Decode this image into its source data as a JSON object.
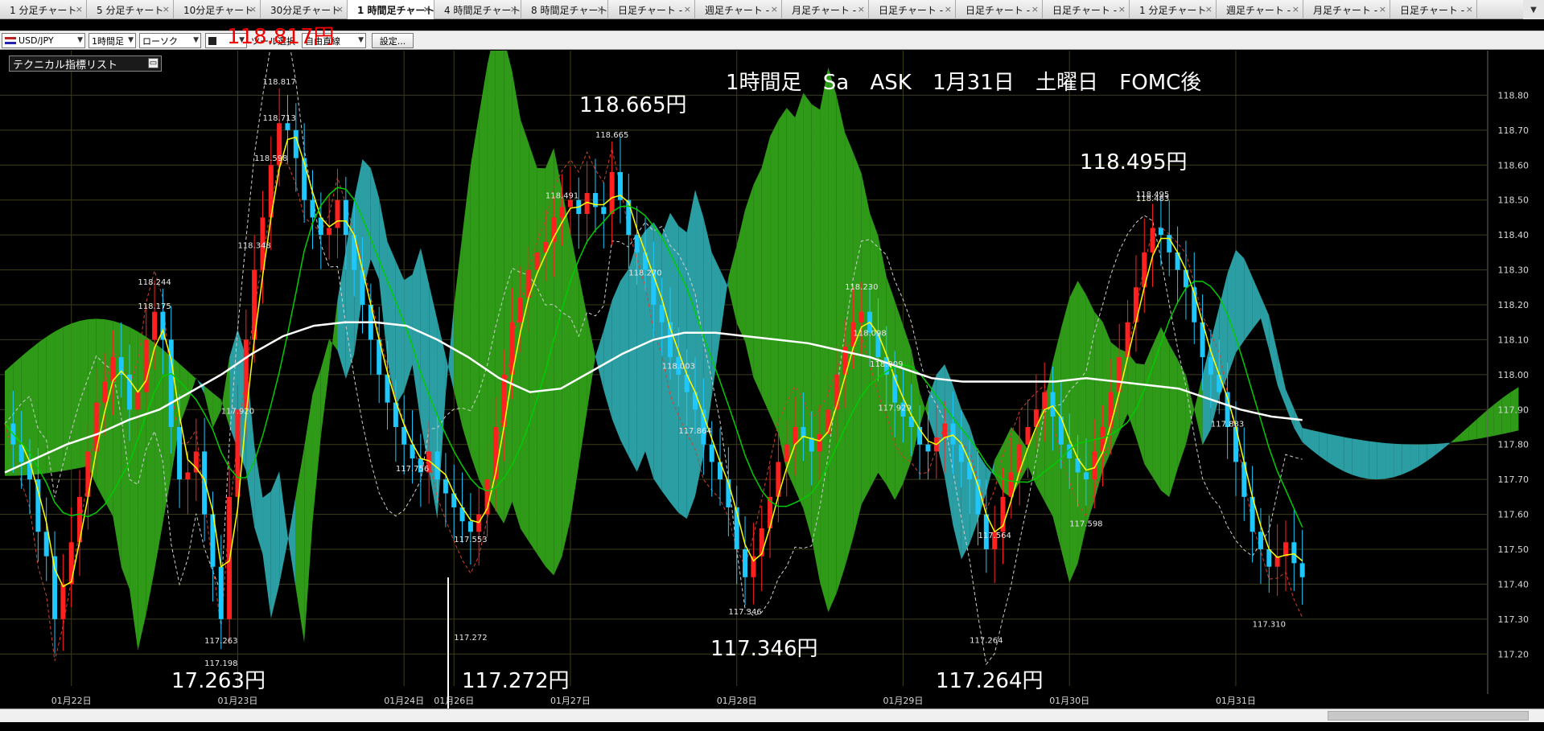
{
  "tabs": [
    {
      "label": "1 分足チャート",
      "active": false
    },
    {
      "label": "5 分足チャート",
      "active": false
    },
    {
      "label": "10分足チャート",
      "active": false
    },
    {
      "label": "30分足チャート",
      "active": false
    },
    {
      "label": "1 時間足チャート",
      "active": true
    },
    {
      "label": "4 時間足チャート",
      "active": false
    },
    {
      "label": "8 時間足チャート",
      "active": false
    },
    {
      "label": "日足チャート -",
      "active": false
    },
    {
      "label": "週足チャート -",
      "active": false
    },
    {
      "label": "月足チャート -",
      "active": false
    },
    {
      "label": "日足チャート -",
      "active": false
    },
    {
      "label": "日足チャート -",
      "active": false
    },
    {
      "label": "日足チャート -",
      "active": false
    },
    {
      "label": "1 分足チャート",
      "active": false
    },
    {
      "label": "週足チャート -",
      "active": false
    },
    {
      "label": "月足チャート -",
      "active": false
    },
    {
      "label": "日足チャート -",
      "active": false
    }
  ],
  "tab_close_glyph": "×",
  "tab_scroll_glyph": "▼",
  "toolbar": {
    "symbol": "USD/JPY",
    "timeframe": "1時間足",
    "chart_type": "ローソク",
    "tool_label": "ツール選択",
    "tool": "自由直線",
    "settings": "設定..."
  },
  "overlays": {
    "title": "1時間足 Sa ASK 1月31日 土曜日 FOMC後",
    "price_red": "118.817円",
    "tech_list": "テクニカル指標リスト",
    "callouts": [
      "118.665円",
      "118.495円",
      "17.263円",
      "117.272円",
      "117.346円",
      "117.264円"
    ]
  },
  "colors": {
    "background": "#000000",
    "bull_candle": "#ff2020",
    "bear_candle": "#1ec8ff",
    "sma_short": "#ffff00",
    "sma_mid": "#00cc00",
    "sma_long": "#ffffff",
    "kumo_bull": "#2e9a18",
    "kumo_bear": "#2a9ea3",
    "grid": "#3d3d18"
  },
  "chart_data": {
    "type": "candlestick",
    "symbol": "USD/JPY",
    "timeframe": "1時間足",
    "ylim": [
      117.15,
      118.9
    ],
    "y_ticks": [
      "118.80",
      "118.70",
      "118.60",
      "118.50",
      "118.40",
      "118.30",
      "118.20",
      "118.10",
      "118.00",
      "117.90",
      "117.80",
      "117.70",
      "117.60",
      "117.50",
      "117.40",
      "117.30",
      "117.20"
    ],
    "x_ticks": [
      {
        "label": "01月22日",
        "t": 8
      },
      {
        "label": "01月23日",
        "t": 28
      },
      {
        "label": "01月24日",
        "t": 48
      },
      {
        "label": "01月26日",
        "t": 54
      },
      {
        "label": "01月27日",
        "t": 68
      },
      {
        "label": "01月28日",
        "t": 88
      },
      {
        "label": "01月29日",
        "t": 108
      },
      {
        "label": "01月30日",
        "t": 128
      },
      {
        "label": "01月31日",
        "t": 148
      }
    ],
    "candle_close": [
      117.86,
      117.8,
      117.75,
      117.7,
      117.55,
      117.48,
      117.3,
      117.4,
      117.52,
      117.65,
      117.78,
      117.92,
      117.98,
      118.05,
      118.0,
      117.9,
      117.95,
      118.1,
      118.18,
      118.1,
      117.85,
      117.7,
      117.72,
      117.78,
      117.6,
      117.45,
      117.3,
      117.65,
      117.9,
      118.1,
      118.3,
      118.45,
      118.6,
      118.72,
      118.7,
      118.62,
      118.5,
      118.45,
      118.4,
      118.42,
      118.5,
      118.4,
      118.3,
      118.2,
      118.1,
      118.0,
      117.92,
      117.85,
      117.8,
      117.76,
      117.72,
      117.78,
      117.7,
      117.66,
      117.62,
      117.58,
      117.55,
      117.6,
      117.7,
      117.85,
      118.0,
      118.15,
      118.22,
      118.3,
      118.35,
      118.38,
      118.45,
      118.48,
      118.5,
      118.46,
      118.52,
      118.48,
      118.46,
      118.58,
      118.5,
      118.4,
      118.35,
      118.3,
      118.2,
      118.15,
      118.05,
      118.0,
      117.95,
      117.9,
      117.8,
      117.75,
      117.7,
      117.62,
      117.5,
      117.42,
      117.48,
      117.56,
      117.65,
      117.75,
      117.8,
      117.85,
      117.82,
      117.78,
      117.83,
      117.9,
      118.0,
      118.08,
      118.15,
      118.18,
      118.12,
      118.05,
      118.0,
      117.92,
      117.88,
      117.85,
      117.8,
      117.78,
      117.82,
      117.86,
      117.8,
      117.75,
      117.7,
      117.6,
      117.5,
      117.55,
      117.65,
      117.72,
      117.8,
      117.85,
      117.9,
      117.95,
      117.88,
      117.8,
      117.76,
      117.72,
      117.7,
      117.78,
      117.85,
      117.95,
      118.05,
      118.15,
      118.25,
      118.35,
      118.42,
      118.4,
      118.35,
      118.3,
      118.25,
      118.15,
      118.05,
      118.0,
      117.95,
      117.85,
      117.75,
      117.65,
      117.55,
      117.5,
      117.45,
      117.48,
      117.52,
      117.46,
      117.42
    ],
    "sma_long": [
      117.72,
      117.76,
      117.8,
      117.83,
      117.87,
      117.9,
      117.95,
      118.0,
      118.06,
      118.11,
      118.14,
      118.15,
      118.15,
      118.14,
      118.1,
      118.05,
      117.99,
      117.95,
      117.96,
      118.01,
      118.06,
      118.1,
      118.12,
      118.12,
      118.11,
      118.1,
      118.09,
      118.07,
      118.05,
      118.02,
      117.99,
      117.98,
      117.98,
      117.98,
      117.98,
      117.99,
      117.98,
      117.97,
      117.96,
      117.93,
      117.9,
      117.88,
      117.87
    ],
    "callout_labels": [
      "118.817",
      "118.713",
      "118.598",
      "118.244",
      "118.175",
      "118.348",
      "117.920",
      "117.756",
      "117.263",
      "117.198",
      "117.553",
      "117.272",
      "118.491",
      "118.665",
      "117.864",
      "117.346",
      "118.003",
      "118.270",
      "118.230",
      "117.929",
      "117.564",
      "118.009",
      "118.098",
      "117.264",
      "117.598",
      "118.495",
      "118.483",
      "117.883",
      "117.310"
    ]
  }
}
